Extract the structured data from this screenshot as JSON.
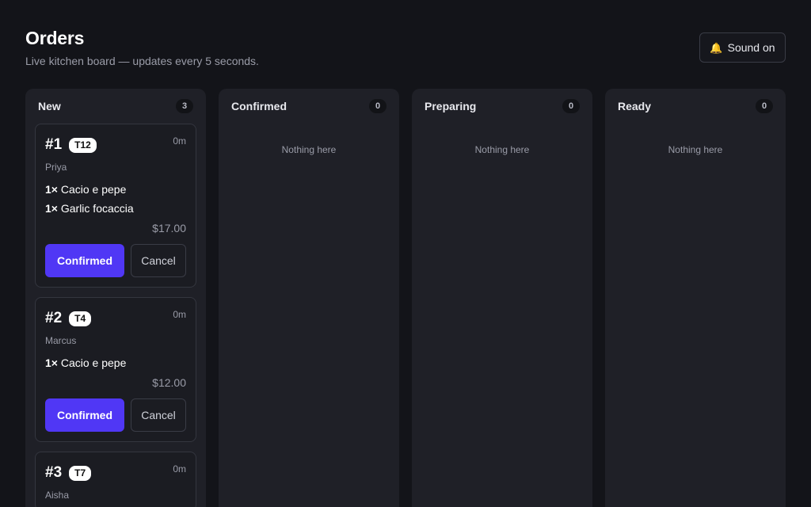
{
  "header": {
    "title": "Orders",
    "subtitle": "Live kitchen board — updates every 5 seconds.",
    "sound_label": "Sound on",
    "sound_icon": "bell-icon"
  },
  "colors": {
    "background": "#131419",
    "column": "#1f2027",
    "accent": "#5037f5",
    "bell": "#f4c430"
  },
  "columns": [
    {
      "title": "New",
      "count": "3",
      "empty_text": "",
      "orders": [
        {
          "number": "#1",
          "table": "T12",
          "age": "0m",
          "customer": "Priya",
          "items": [
            {
              "qty": "1×",
              "name": "Cacio e pepe"
            },
            {
              "qty": "1×",
              "name": "Garlic focaccia"
            }
          ],
          "total": "$17.00",
          "confirm_label": "Confirmed",
          "cancel_label": "Cancel"
        },
        {
          "number": "#2",
          "table": "T4",
          "age": "0m",
          "customer": "Marcus",
          "items": [
            {
              "qty": "1×",
              "name": "Cacio e pepe"
            }
          ],
          "total": "$12.00",
          "confirm_label": "Confirmed",
          "cancel_label": "Cancel"
        },
        {
          "number": "#3",
          "table": "T7",
          "age": "0m",
          "customer": "Aisha",
          "items": [],
          "total": "",
          "confirm_label": "",
          "cancel_label": ""
        }
      ]
    },
    {
      "title": "Confirmed",
      "count": "0",
      "empty_text": "Nothing here",
      "orders": []
    },
    {
      "title": "Preparing",
      "count": "0",
      "empty_text": "Nothing here",
      "orders": []
    },
    {
      "title": "Ready",
      "count": "0",
      "empty_text": "Nothing here",
      "orders": []
    }
  ]
}
